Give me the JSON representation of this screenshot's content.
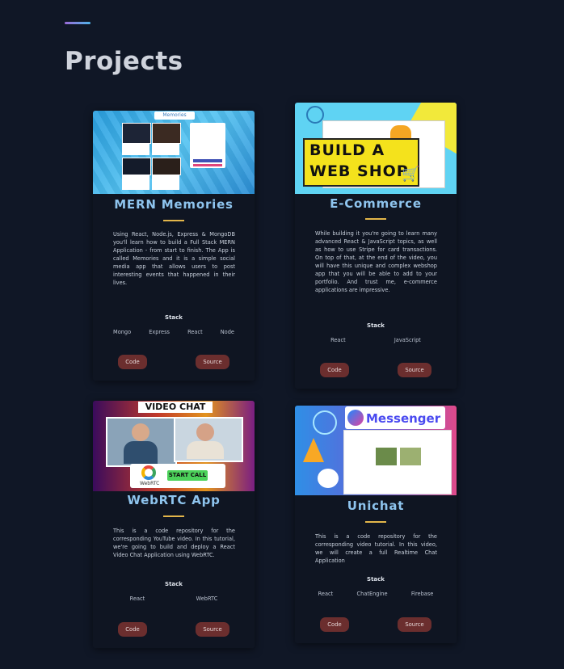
{
  "page": {
    "title": "Projects"
  },
  "projects": [
    {
      "title": "MERN Memories",
      "description": "Using React, Node.js, Express & MongoDB you'll learn how to build a Full Stack MERN Application - from start to finish. The App is called Memories and it is a simple social media app that allows users to post interesting events that happened in their lives.",
      "stack_label": "Stack",
      "stack": [
        "Mongo",
        "Express",
        "React",
        "Node"
      ],
      "code_label": "Code",
      "source_label": "Source",
      "thumbnail": {
        "banner_text": "Memories"
      }
    },
    {
      "title": "E-Commerce",
      "description": "While building it you're going to learn many advanced React & JavaScript topics, as well as how to use Stripe for card transactions. On top of that, at the end of the video, you will have this unique and complex webshop app that you will be able to add to your portfolio. And trust me, e-commerce applications are impressive.",
      "stack_label": "Stack",
      "stack": [
        "React",
        "JavaScript"
      ],
      "code_label": "Code",
      "source_label": "Source",
      "thumbnail": {
        "line1": "BUILD A",
        "line2": "WEB SHOP"
      }
    },
    {
      "title": "WebRTC App",
      "description": "This is a code repository for the corresponding YouTube video. In this tutorial, we're going to build and deploy a React Video Chat Application using WebRTC.",
      "stack_label": "Stack",
      "stack": [
        "React",
        "WebRTC"
      ],
      "code_label": "Code",
      "source_label": "Source",
      "thumbnail": {
        "header": "VIDEO CHAT",
        "button": "START CALL",
        "logo_text": "WebRTC"
      }
    },
    {
      "title": "Unichat",
      "description": "This is a code repository for the corresponding video tutorial. In this video, we will create a full Realtime Chat Application",
      "stack_label": "Stack",
      "stack": [
        "React",
        "ChatEngine",
        "Firebase"
      ],
      "code_label": "Code",
      "source_label": "Source",
      "thumbnail": {
        "banner_text": "Messenger"
      }
    }
  ],
  "colors": {
    "background": "#101726",
    "card": "#0f1522",
    "title_blue": "#8ec4ee",
    "underline_gold": "#e3b64a",
    "button": "#6b2e2e"
  }
}
